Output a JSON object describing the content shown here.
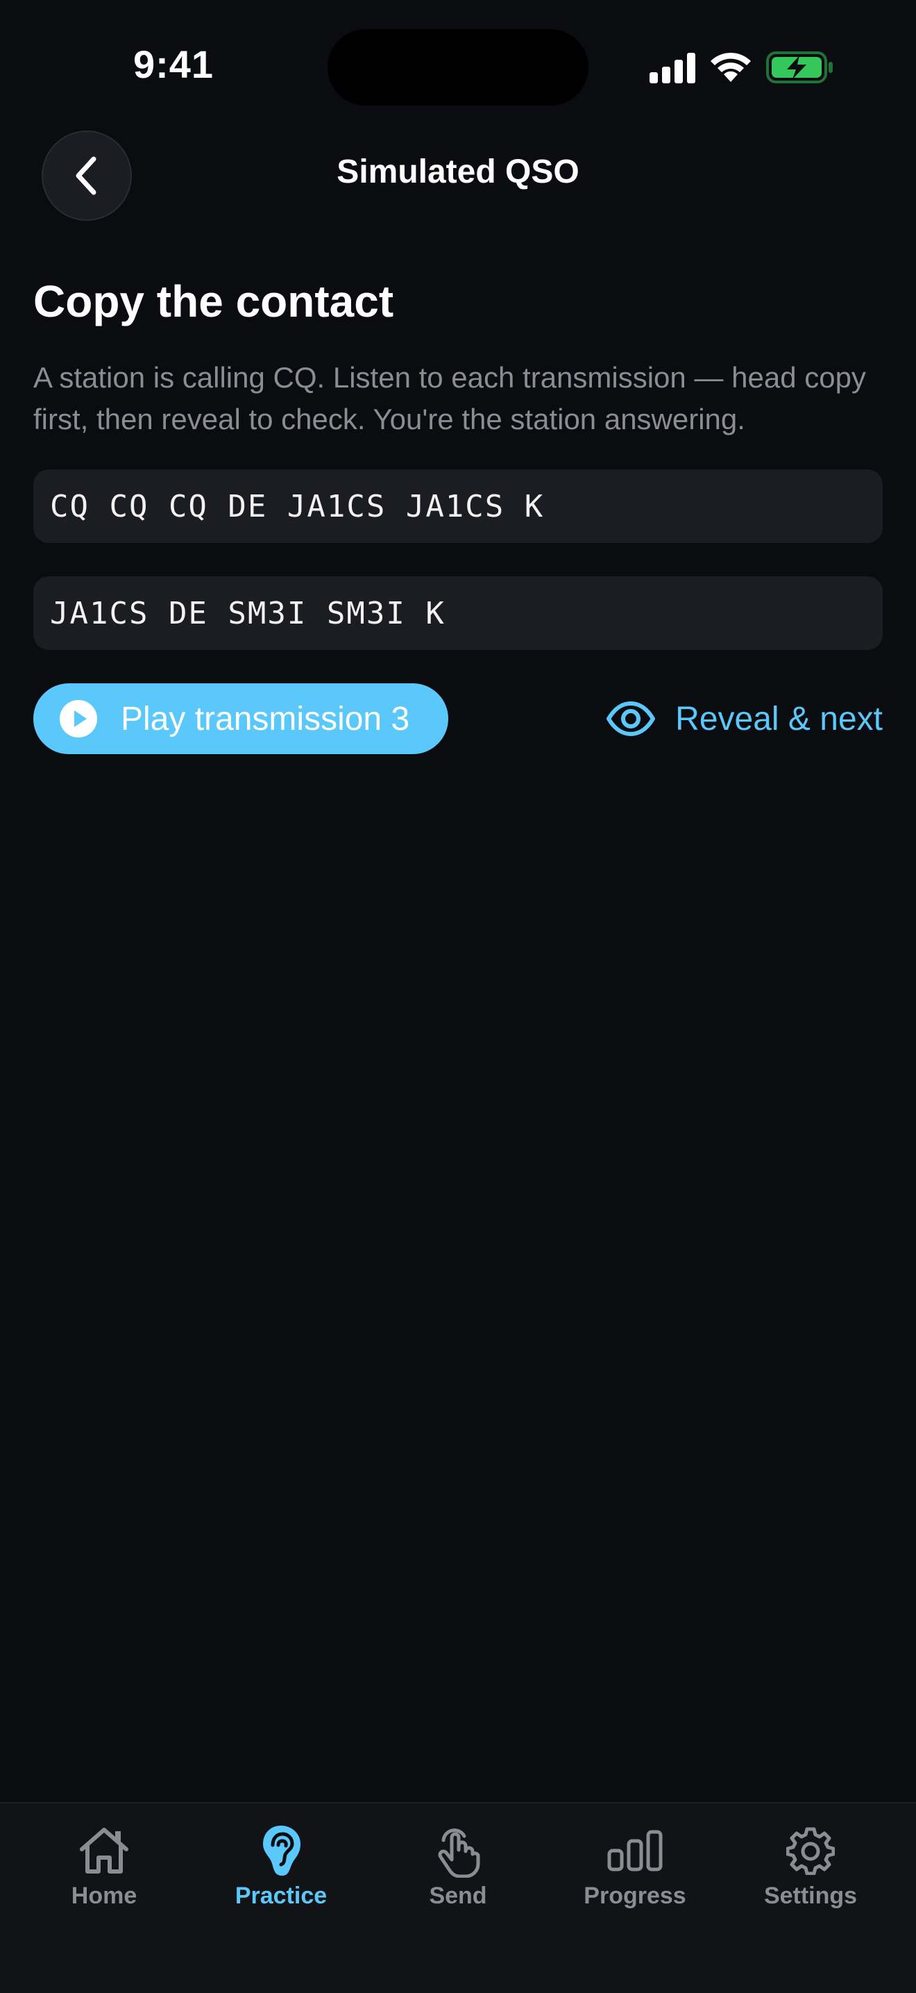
{
  "status_bar": {
    "time": "9:41",
    "signal_icon": "cellular-signal-icon",
    "wifi_icon": "wifi-icon",
    "battery_icon": "battery-charging-icon",
    "battery_color": "#34c759"
  },
  "header": {
    "title": "Simulated QSO",
    "back_icon": "chevron-left-icon"
  },
  "main": {
    "title": "Copy the contact",
    "description": "A station is calling CQ. Listen to each transmission — head copy first, then reveal to check. You're the station answering.",
    "transmissions": [
      "CQ CQ CQ DE JA1CS JA1CS K",
      "JA1CS DE SM3I SM3I K"
    ],
    "play_button": {
      "label": "Play transmission 3",
      "icon": "play-circle-icon"
    },
    "reveal_button": {
      "label": "Reveal & next",
      "icon": "eye-icon"
    }
  },
  "tab_bar": {
    "items": [
      {
        "label": "Home",
        "icon": "house-icon",
        "active": false
      },
      {
        "label": "Practice",
        "icon": "ear-icon",
        "active": true
      },
      {
        "label": "Send",
        "icon": "tap-hand-icon",
        "active": false
      },
      {
        "label": "Progress",
        "icon": "bar-chart-icon",
        "active": false
      },
      {
        "label": "Settings",
        "icon": "gear-icon",
        "active": false
      }
    ]
  },
  "colors": {
    "background": "#0b0c10",
    "card": "#1c1d22",
    "accent": "#5ac8fa",
    "muted_text": "#8b8d94"
  }
}
